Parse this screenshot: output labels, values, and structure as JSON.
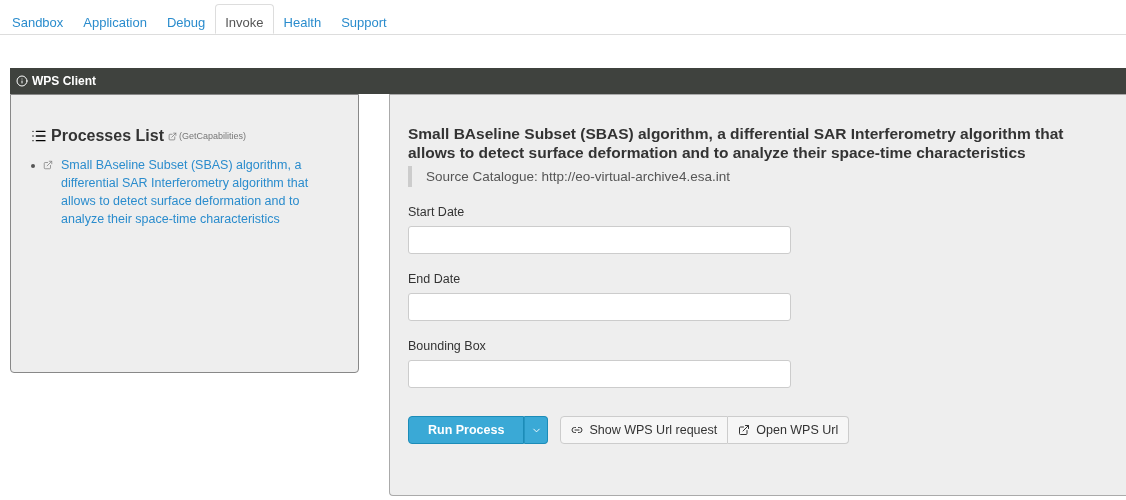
{
  "tabs": [
    {
      "label": "Sandbox",
      "selected": false
    },
    {
      "label": "Application",
      "selected": false
    },
    {
      "label": "Debug",
      "selected": false
    },
    {
      "label": "Invoke",
      "selected": true
    },
    {
      "label": "Health",
      "selected": false
    },
    {
      "label": "Support",
      "selected": false
    }
  ],
  "panel_header": {
    "title": "WPS Client"
  },
  "processes": {
    "title": "Processes List",
    "capabilities_link": "(GetCapabilities)",
    "items": [
      {
        "label": "Small BAseline Subset (SBAS) algorithm, a differential SAR Interferometry algorithm that allows to detect surface deformation and to analyze their space-time characteristics"
      }
    ]
  },
  "process": {
    "title": "Small BAseline Subset (SBAS) algorithm, a differential SAR Interferometry algorithm that allows to detect surface deformation and to analyze their space-time characteristics",
    "source": "Source Catalogue: http://eo-virtual-archive4.esa.int",
    "fields": [
      {
        "label": "Start Date"
      },
      {
        "label": "End Date"
      },
      {
        "label": "Bounding Box"
      }
    ],
    "buttons": {
      "run": "Run Process",
      "show_url": "Show WPS Url request",
      "open_url": "Open WPS Url"
    }
  }
}
